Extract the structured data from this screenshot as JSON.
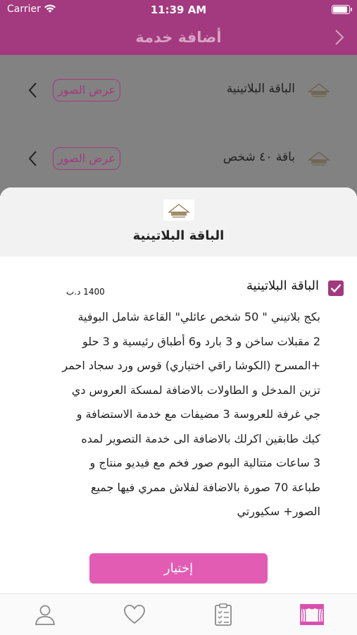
{
  "status_bar": {
    "carrier": "Carrier",
    "time": "11:39 AM"
  },
  "nav": {
    "title": "أضافة خدمة"
  },
  "list": {
    "items": [
      {
        "name": "الباقة البلاتينية",
        "button_label": "عرض الصور"
      },
      {
        "name": "باقة ٤٠ شخص",
        "button_label": "عرض الصور"
      }
    ]
  },
  "sheet": {
    "title": "الباقة البلاتينية",
    "package": {
      "name": "الباقة البلاتينية",
      "price": "1400 د.ب",
      "checked": true,
      "description_lines": [
        "بكج بلاتيني \" 50 شخص عائلي\" القاعة شامل البوفية",
        "2 مقبلات ساخن و 3 بارد  و6 أطباق رئيسية و 3 حلو",
        "+المسرح (الكوشا راقي اختياري) قوس ورد سجاد احمر",
        "تزين المدخل و الطاولات  بالاضافة لمسكة العروس دي",
        "جي غرفة للعروسة 3 مضيفات مع خدمة الاستضافة و",
        "كيك طابقين اكرلك  بالاضافة الى خدمة التصوير لمده",
        "3 ساعات متتالية البوم صور فخم مع فيديو منتاج و",
        "طباعة 70 صورة بالاضافة لفلاش ممري فيها جميع",
        "الصور+ سكيورتي"
      ]
    },
    "select_label": "إختيار"
  },
  "tabbar": {
    "icons": [
      "profile-icon",
      "heart-icon",
      "clipboard-icon",
      "stage-icon"
    ]
  },
  "colors": {
    "brand": "#a3397e",
    "button": "#e25cb4",
    "dim_overlay": "#828282"
  }
}
